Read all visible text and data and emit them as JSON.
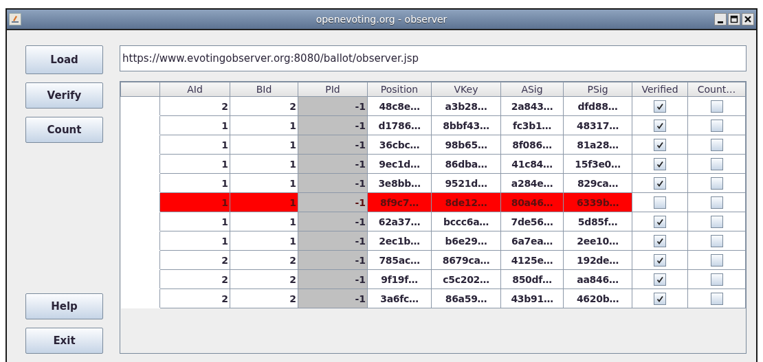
{
  "window": {
    "title": "openevoting.org - observer"
  },
  "top_buttons": [
    "Load",
    "Verify",
    "Count"
  ],
  "bottom_buttons": [
    "Help",
    "Exit"
  ],
  "url_field": {
    "value": "https://www.evotingobserver.org:8080/ballot/observer.jsp"
  },
  "table": {
    "columns": [
      "AId",
      "BId",
      "PId",
      "Position",
      "VKey",
      "ASig",
      "PSig",
      "Verified",
      "Count…"
    ],
    "rows": [
      {
        "aid": "2",
        "bid": "2",
        "pid": "-1",
        "position": "48c8e…",
        "vkey": "a3b28…",
        "asig": "2a843…",
        "psig": "dfd88…",
        "verified": true,
        "counted": false,
        "flagged": false
      },
      {
        "aid": "1",
        "bid": "1",
        "pid": "-1",
        "position": "d1786…",
        "vkey": "8bbf43…",
        "asig": "fc3b1…",
        "psig": "48317…",
        "verified": true,
        "counted": false,
        "flagged": false
      },
      {
        "aid": "1",
        "bid": "1",
        "pid": "-1",
        "position": "36cbc…",
        "vkey": "98b65…",
        "asig": "8f086…",
        "psig": "81a28…",
        "verified": true,
        "counted": false,
        "flagged": false
      },
      {
        "aid": "1",
        "bid": "1",
        "pid": "-1",
        "position": "9ec1d…",
        "vkey": "86dba…",
        "asig": "41c84…",
        "psig": "15f3e0…",
        "verified": true,
        "counted": false,
        "flagged": false
      },
      {
        "aid": "1",
        "bid": "1",
        "pid": "-1",
        "position": "3e8bb…",
        "vkey": "9521d…",
        "asig": "a284e…",
        "psig": "829ca…",
        "verified": true,
        "counted": false,
        "flagged": false
      },
      {
        "aid": "1",
        "bid": "1",
        "pid": "-1",
        "position": "8f9c7…",
        "vkey": "8de12…",
        "asig": "80a46…",
        "psig": "6339b…",
        "verified": false,
        "counted": false,
        "flagged": true
      },
      {
        "aid": "1",
        "bid": "1",
        "pid": "-1",
        "position": "62a37…",
        "vkey": "bccc6a…",
        "asig": "7de56…",
        "psig": "5d85f…",
        "verified": true,
        "counted": false,
        "flagged": false
      },
      {
        "aid": "1",
        "bid": "1",
        "pid": "-1",
        "position": "2ec1b…",
        "vkey": "b6e29…",
        "asig": "6a7ea…",
        "psig": "2ee10…",
        "verified": true,
        "counted": false,
        "flagged": false
      },
      {
        "aid": "2",
        "bid": "2",
        "pid": "-1",
        "position": "785ac…",
        "vkey": "8679ca…",
        "asig": "4125e…",
        "psig": "192de…",
        "verified": true,
        "counted": false,
        "flagged": false
      },
      {
        "aid": "2",
        "bid": "2",
        "pid": "-1",
        "position": "9f19f…",
        "vkey": "c5c202…",
        "asig": "850df…",
        "psig": "aa846…",
        "verified": true,
        "counted": false,
        "flagged": false
      },
      {
        "aid": "2",
        "bid": "2",
        "pid": "-1",
        "position": "3a6fc…",
        "vkey": "86a59…",
        "asig": "43b91…",
        "psig": "4620b…",
        "verified": true,
        "counted": false,
        "flagged": false
      }
    ]
  }
}
